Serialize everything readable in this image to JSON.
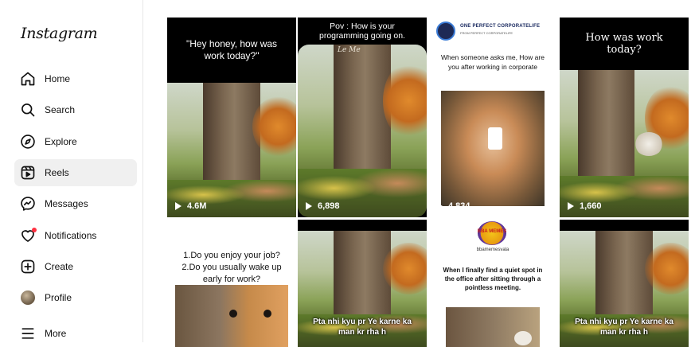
{
  "app": {
    "logo": "Instagram"
  },
  "nav": [
    {
      "label": "Home",
      "icon": "home-icon"
    },
    {
      "label": "Search",
      "icon": "search-icon"
    },
    {
      "label": "Explore",
      "icon": "compass-icon"
    },
    {
      "label": "Reels",
      "icon": "reels-icon",
      "active": true
    },
    {
      "label": "Messages",
      "icon": "messenger-icon"
    },
    {
      "label": "Notifications",
      "icon": "heart-icon"
    },
    {
      "label": "Create",
      "icon": "plus-square-icon"
    },
    {
      "label": "Profile",
      "icon": "avatar"
    },
    {
      "label": "More",
      "icon": "hamburger-icon"
    }
  ],
  "reels": [
    {
      "caption": "\"Hey honey, how was work today?\"",
      "views": "4.6M"
    },
    {
      "caption": "Pov : How is your programming going on.",
      "watermark": "Le Me",
      "views": "6,898"
    },
    {
      "brand": "ONE PERFECT CORPORATELIFE",
      "brand_sub": "FROM PERFECT CORPORATELIFE",
      "caption": "When someone asks me, How are you after working in corporate",
      "views": "4,834"
    },
    {
      "caption": "How was work today?",
      "views": "1,660"
    },
    {
      "caption": "1.Do you enjoy your job?\n2.Do you usually wake up early for work?"
    },
    {
      "subtitle": "Pta nhi kyu pr Ye karne ka man kr rha h"
    },
    {
      "brand": "BBA MEMES",
      "handle": "bbamemesvala",
      "caption": "When I finally find a quiet spot in the office after sitting through a pointless meeting."
    },
    {
      "subtitle": "Pta nhi kyu pr Ye karne ka man kr rha h"
    }
  ]
}
